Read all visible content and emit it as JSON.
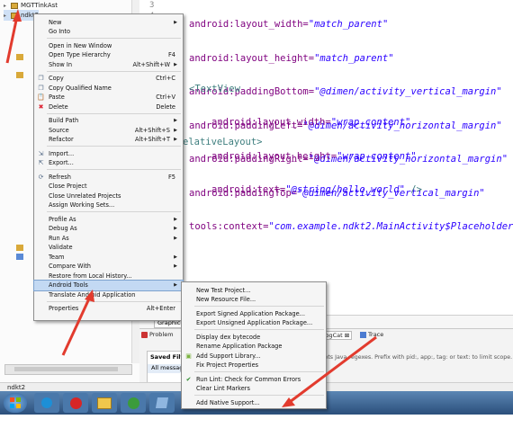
{
  "tree": {
    "items": [
      {
        "label": "MGTTinkAst"
      },
      {
        "label": "ndkt2"
      }
    ]
  },
  "editor": {
    "line_numbers": [
      "3",
      "4"
    ],
    "lines": [
      {
        "attr": "android:layout_width=",
        "val": "\"match_parent\""
      },
      {
        "attr": "android:layout_height=",
        "val": "\"match_parent\""
      },
      {
        "attr": "android:paddingBottom=",
        "val": "\"@dimen/activity_vertical_margin\""
      },
      {
        "attr": "android:paddingLeft=",
        "val": "\"@dimen/activity_horizontal_margin\""
      },
      {
        "attr": "android:paddingRight=",
        "val": "\"@dimen/activity_horizontal_margin\""
      },
      {
        "attr": "android:paddingTop=",
        "val": "\"@dimen/activity_vertical_margin\""
      },
      {
        "attr": "tools:context=",
        "val": "\"com.example.ndkt2.MainActivity$PlaceholderFra"
      }
    ],
    "textview_open": "<TextView",
    "tv_lines": [
      {
        "attr": "android:layout_width=",
        "val": "\"wrap_content\""
      },
      {
        "attr": "android:layout_height=",
        "val": "\"wrap_content\""
      },
      {
        "attr": "android:text=",
        "val": "\"@string/hello_world\"",
        "end": " />"
      }
    ],
    "closing": "elativeLayout>"
  },
  "bottom": {
    "tab_problems": "Problem",
    "tab_graphical": "Graphical",
    "tab_logcat": "LogCat",
    "tab_logcat_suffix": "⊠",
    "tab_trace": "Trace",
    "saved_filters": "Saved Filte",
    "all_messages": "All messag",
    "hint": "cepts Java regexes. Prefix with pid:, app:, tag: or text: to limit scope."
  },
  "status": {
    "project": "ndkt2"
  },
  "context_menu": {
    "items": [
      {
        "label": "New",
        "submenu": true
      },
      {
        "label": "Go Into"
      },
      {
        "sep": true
      },
      {
        "label": "Open in New Window"
      },
      {
        "label": "Open Type Hierarchy",
        "shortcut": "F4"
      },
      {
        "label": "Show In",
        "shortcut": "Alt+Shift+W",
        "submenu": true
      },
      {
        "sep": true
      },
      {
        "label": "Copy",
        "shortcut": "Ctrl+C",
        "icon": "copy"
      },
      {
        "label": "Copy Qualified Name",
        "icon": "copy"
      },
      {
        "label": "Paste",
        "shortcut": "Ctrl+V",
        "icon": "paste"
      },
      {
        "label": "Delete",
        "shortcut": "Delete",
        "icon": "delete"
      },
      {
        "sep": true
      },
      {
        "label": "Build Path",
        "submenu": true
      },
      {
        "label": "Source",
        "shortcut": "Alt+Shift+S",
        "submenu": true
      },
      {
        "label": "Refactor",
        "shortcut": "Alt+Shift+T",
        "submenu": true
      },
      {
        "sep": true
      },
      {
        "label": "Import...",
        "icon": "import"
      },
      {
        "label": "Export...",
        "icon": "export"
      },
      {
        "sep": true
      },
      {
        "label": "Refresh",
        "shortcut": "F5",
        "icon": "refresh"
      },
      {
        "label": "Close Project"
      },
      {
        "label": "Close Unrelated Projects"
      },
      {
        "label": "Assign Working Sets..."
      },
      {
        "sep": true
      },
      {
        "label": "Profile As",
        "submenu": true
      },
      {
        "label": "Debug As",
        "submenu": true
      },
      {
        "label": "Run As",
        "submenu": true
      },
      {
        "label": "Validate"
      },
      {
        "label": "Team",
        "submenu": true
      },
      {
        "label": "Compare With",
        "submenu": true
      },
      {
        "label": "Restore from Local History..."
      },
      {
        "label": "Android Tools",
        "submenu": true,
        "highlight": true
      },
      {
        "label": "Translate Android Application"
      },
      {
        "sep": true
      },
      {
        "label": "Properties",
        "shortcut": "Alt+Enter"
      }
    ]
  },
  "submenu": {
    "items": [
      {
        "label": "New Test Project..."
      },
      {
        "label": "New Resource File..."
      },
      {
        "sep": true
      },
      {
        "label": "Export Signed Application Package..."
      },
      {
        "label": "Export Unsigned Application Package..."
      },
      {
        "sep": true
      },
      {
        "label": "Display dex bytecode"
      },
      {
        "label": "Rename Application Package"
      },
      {
        "label": "Add Support Library...",
        "icon": "android"
      },
      {
        "label": "Fix Project Properties"
      },
      {
        "sep": true
      },
      {
        "label": "Run Lint: Check for Common Errors",
        "icon": "check"
      },
      {
        "label": "Clear Lint Markers"
      },
      {
        "sep": true
      },
      {
        "label": "Add Native Support..."
      }
    ]
  },
  "colors": {
    "arrow": "#e23b2e",
    "menu_bg": "#f5f5f5",
    "highlight": "#c3d9f3"
  }
}
